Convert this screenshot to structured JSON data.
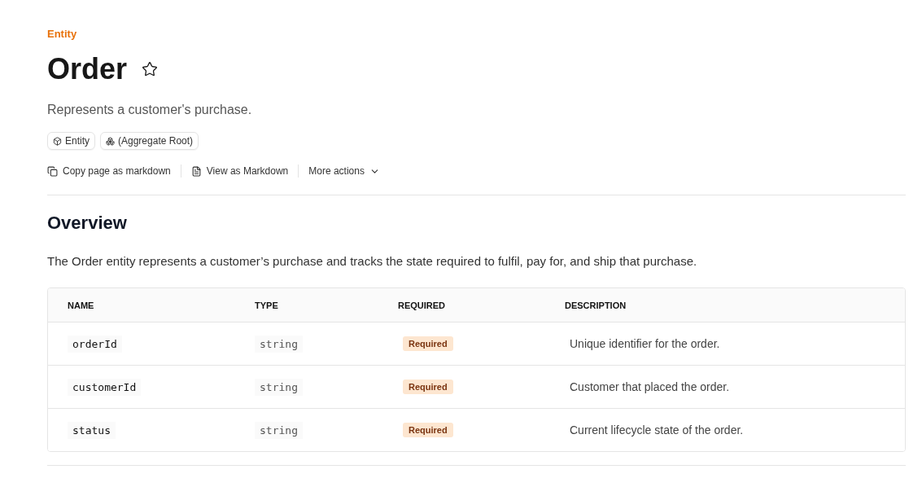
{
  "eyebrow": "Entity",
  "title": "Order",
  "summary": "Represents a customer's purchase.",
  "badges": [
    {
      "kind": "entity",
      "label": "Entity"
    },
    {
      "kind": "aggregate",
      "label": "(Aggregate Root)"
    }
  ],
  "actions": [
    {
      "kind": "copy",
      "label": "Copy page as markdown"
    },
    {
      "kind": "view",
      "label": "View as Markdown"
    },
    {
      "kind": "more",
      "label": "More actions"
    }
  ],
  "section": {
    "heading": "Overview",
    "text": "The Order entity represents a customer’s purchase and tracks the state required to fulfil, pay for, and ship that purchase."
  },
  "table": {
    "columns": [
      "NAME",
      "TYPE",
      "REQUIRED",
      "DESCRIPTION"
    ],
    "rows": [
      {
        "name": "orderId",
        "type": "string",
        "required": "Required",
        "description": "Unique identifier for the order."
      },
      {
        "name": "customerId",
        "type": "string",
        "required": "Required",
        "description": "Customer that placed the order."
      },
      {
        "name": "status",
        "type": "string",
        "required": "Required",
        "description": "Current lifecycle state of the order."
      }
    ]
  }
}
